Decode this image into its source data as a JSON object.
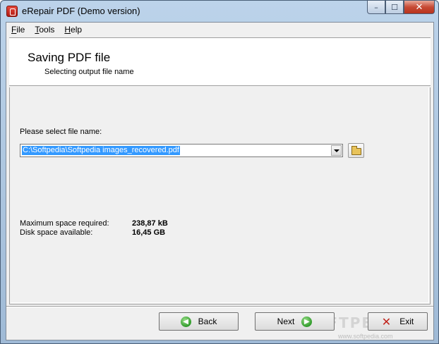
{
  "window": {
    "title": "eRepair PDF (Demo version)",
    "caption_buttons": {
      "minimize": "–",
      "maximize": "☐",
      "close": "✕"
    }
  },
  "menu": [
    {
      "accel": "F",
      "rest": "ile"
    },
    {
      "accel": "T",
      "rest": "ools"
    },
    {
      "accel": "H",
      "rest": "elp"
    }
  ],
  "header": {
    "title": "Saving PDF file",
    "subtitle": "Selecting output file name"
  },
  "form": {
    "select_label": "Please select file name:",
    "file_name": "C:\\Softpedia\\Softpedia images_recovered.pdf"
  },
  "stats": {
    "max_space_label": "Maximum space required:",
    "max_space_value": "238,87 kB",
    "disk_space_label": "Disk space available:",
    "disk_space_value": "16,45 GB"
  },
  "buttons": {
    "back": "Back",
    "next": "Next",
    "exit": "Exit"
  },
  "watermark": {
    "text": "SOFTPEDIA",
    "url": "www.softpedia.com"
  },
  "colors": {
    "selection": "#3399ff",
    "ok_arrow": "#2f9a2a",
    "exit_x": "#c0221a"
  }
}
